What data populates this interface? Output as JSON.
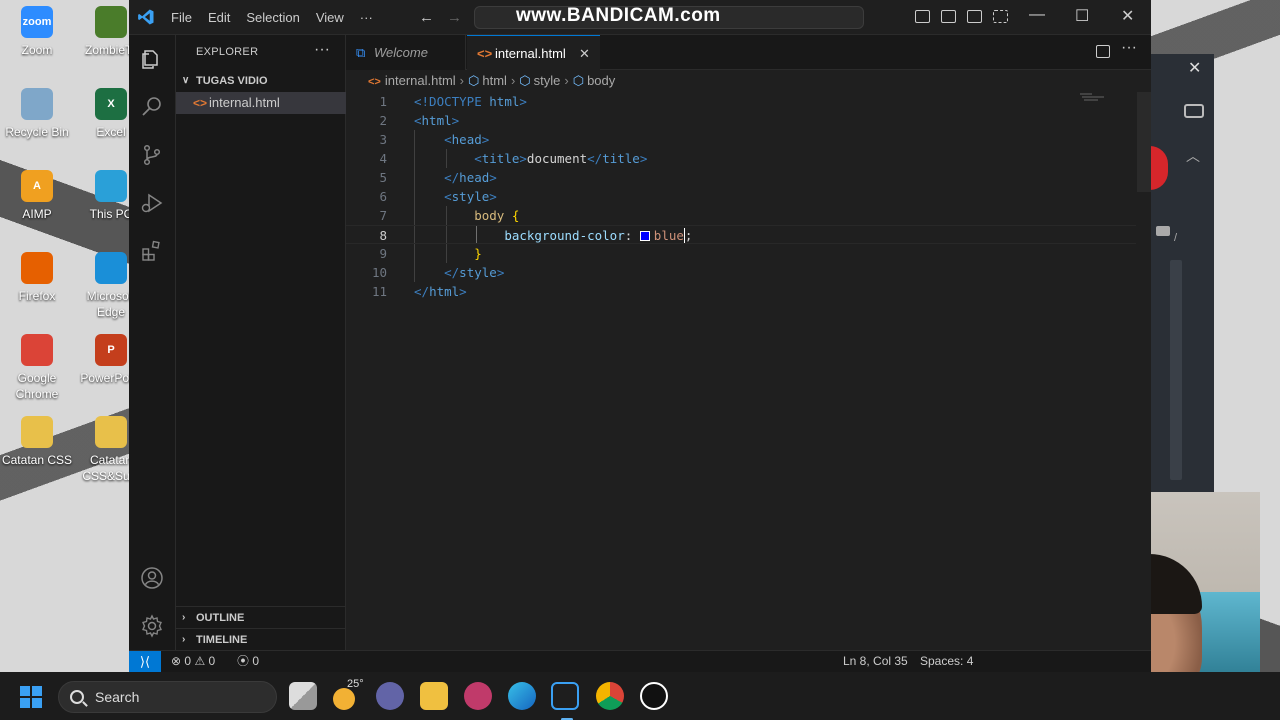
{
  "desktop": {
    "icons": [
      {
        "label": "Zoom",
        "color": "#2d8cff",
        "glyph": "zoom"
      },
      {
        "label": "ZombieTs",
        "color": "#4a7c2a",
        "glyph": ""
      },
      {
        "label": "Recycle Bin",
        "color": "#7fa7c9",
        "glyph": ""
      },
      {
        "label": "Excel",
        "color": "#1d6f42",
        "glyph": "X"
      },
      {
        "label": "AIMP",
        "color": "#f0a020",
        "glyph": "A"
      },
      {
        "label": "This PC",
        "color": "#2aa0d8",
        "glyph": ""
      },
      {
        "label": "Firefox",
        "color": "#e66000",
        "glyph": ""
      },
      {
        "label": "Microsoft Edge",
        "color": "#1a8fd8",
        "glyph": ""
      },
      {
        "label": "Google Chrome",
        "color": "#db4437",
        "glyph": ""
      },
      {
        "label": "PowerPoint",
        "color": "#c43e1c",
        "glyph": "P"
      },
      {
        "label": "Catatan CSS",
        "color": "#e8c04a",
        "glyph": ""
      },
      {
        "label": "Catatan CSS&Sury",
        "color": "#e8c04a",
        "glyph": ""
      }
    ]
  },
  "window": {
    "menu": [
      "File",
      "Edit",
      "Selection",
      "View",
      "···"
    ],
    "watermark": "www.BANDICAM.com",
    "controls": {
      "minimize": "—",
      "maximize": "☐",
      "close": "✕"
    }
  },
  "sidebar": {
    "header": "EXPLORER",
    "more": "···",
    "folder": "TUGAS VIDIO",
    "files": [
      "internal.html"
    ],
    "outline": "OUTLINE",
    "timeline": "TIMELINE"
  },
  "tabs": [
    {
      "label": "Welcome",
      "active": false
    },
    {
      "label": "internal.html",
      "active": true
    }
  ],
  "breadcrumb": [
    "internal.html",
    "html",
    "style",
    "body"
  ],
  "code": {
    "lines": [
      {
        "n": "1"
      },
      {
        "n": "2"
      },
      {
        "n": "3"
      },
      {
        "n": "4"
      },
      {
        "n": "5"
      },
      {
        "n": "6"
      },
      {
        "n": "7"
      },
      {
        "n": "8"
      },
      {
        "n": "9"
      },
      {
        "n": "10"
      },
      {
        "n": "11"
      }
    ],
    "doctype_kw": "!DOCTYPE",
    "doctype_val": "html",
    "html": "html",
    "head": "head",
    "title": "title",
    "title_text": "document",
    "style": "style",
    "selector": "body",
    "property": "background-color",
    "value": "blue",
    "swatch_color": "#0000ff"
  },
  "status": {
    "errors": "0",
    "warnings": "0",
    "ports": "0",
    "position": "Ln 8, Col 35",
    "spaces": "Spaces: 4"
  },
  "taskbar": {
    "search": "Search",
    "temperature": "25°"
  }
}
